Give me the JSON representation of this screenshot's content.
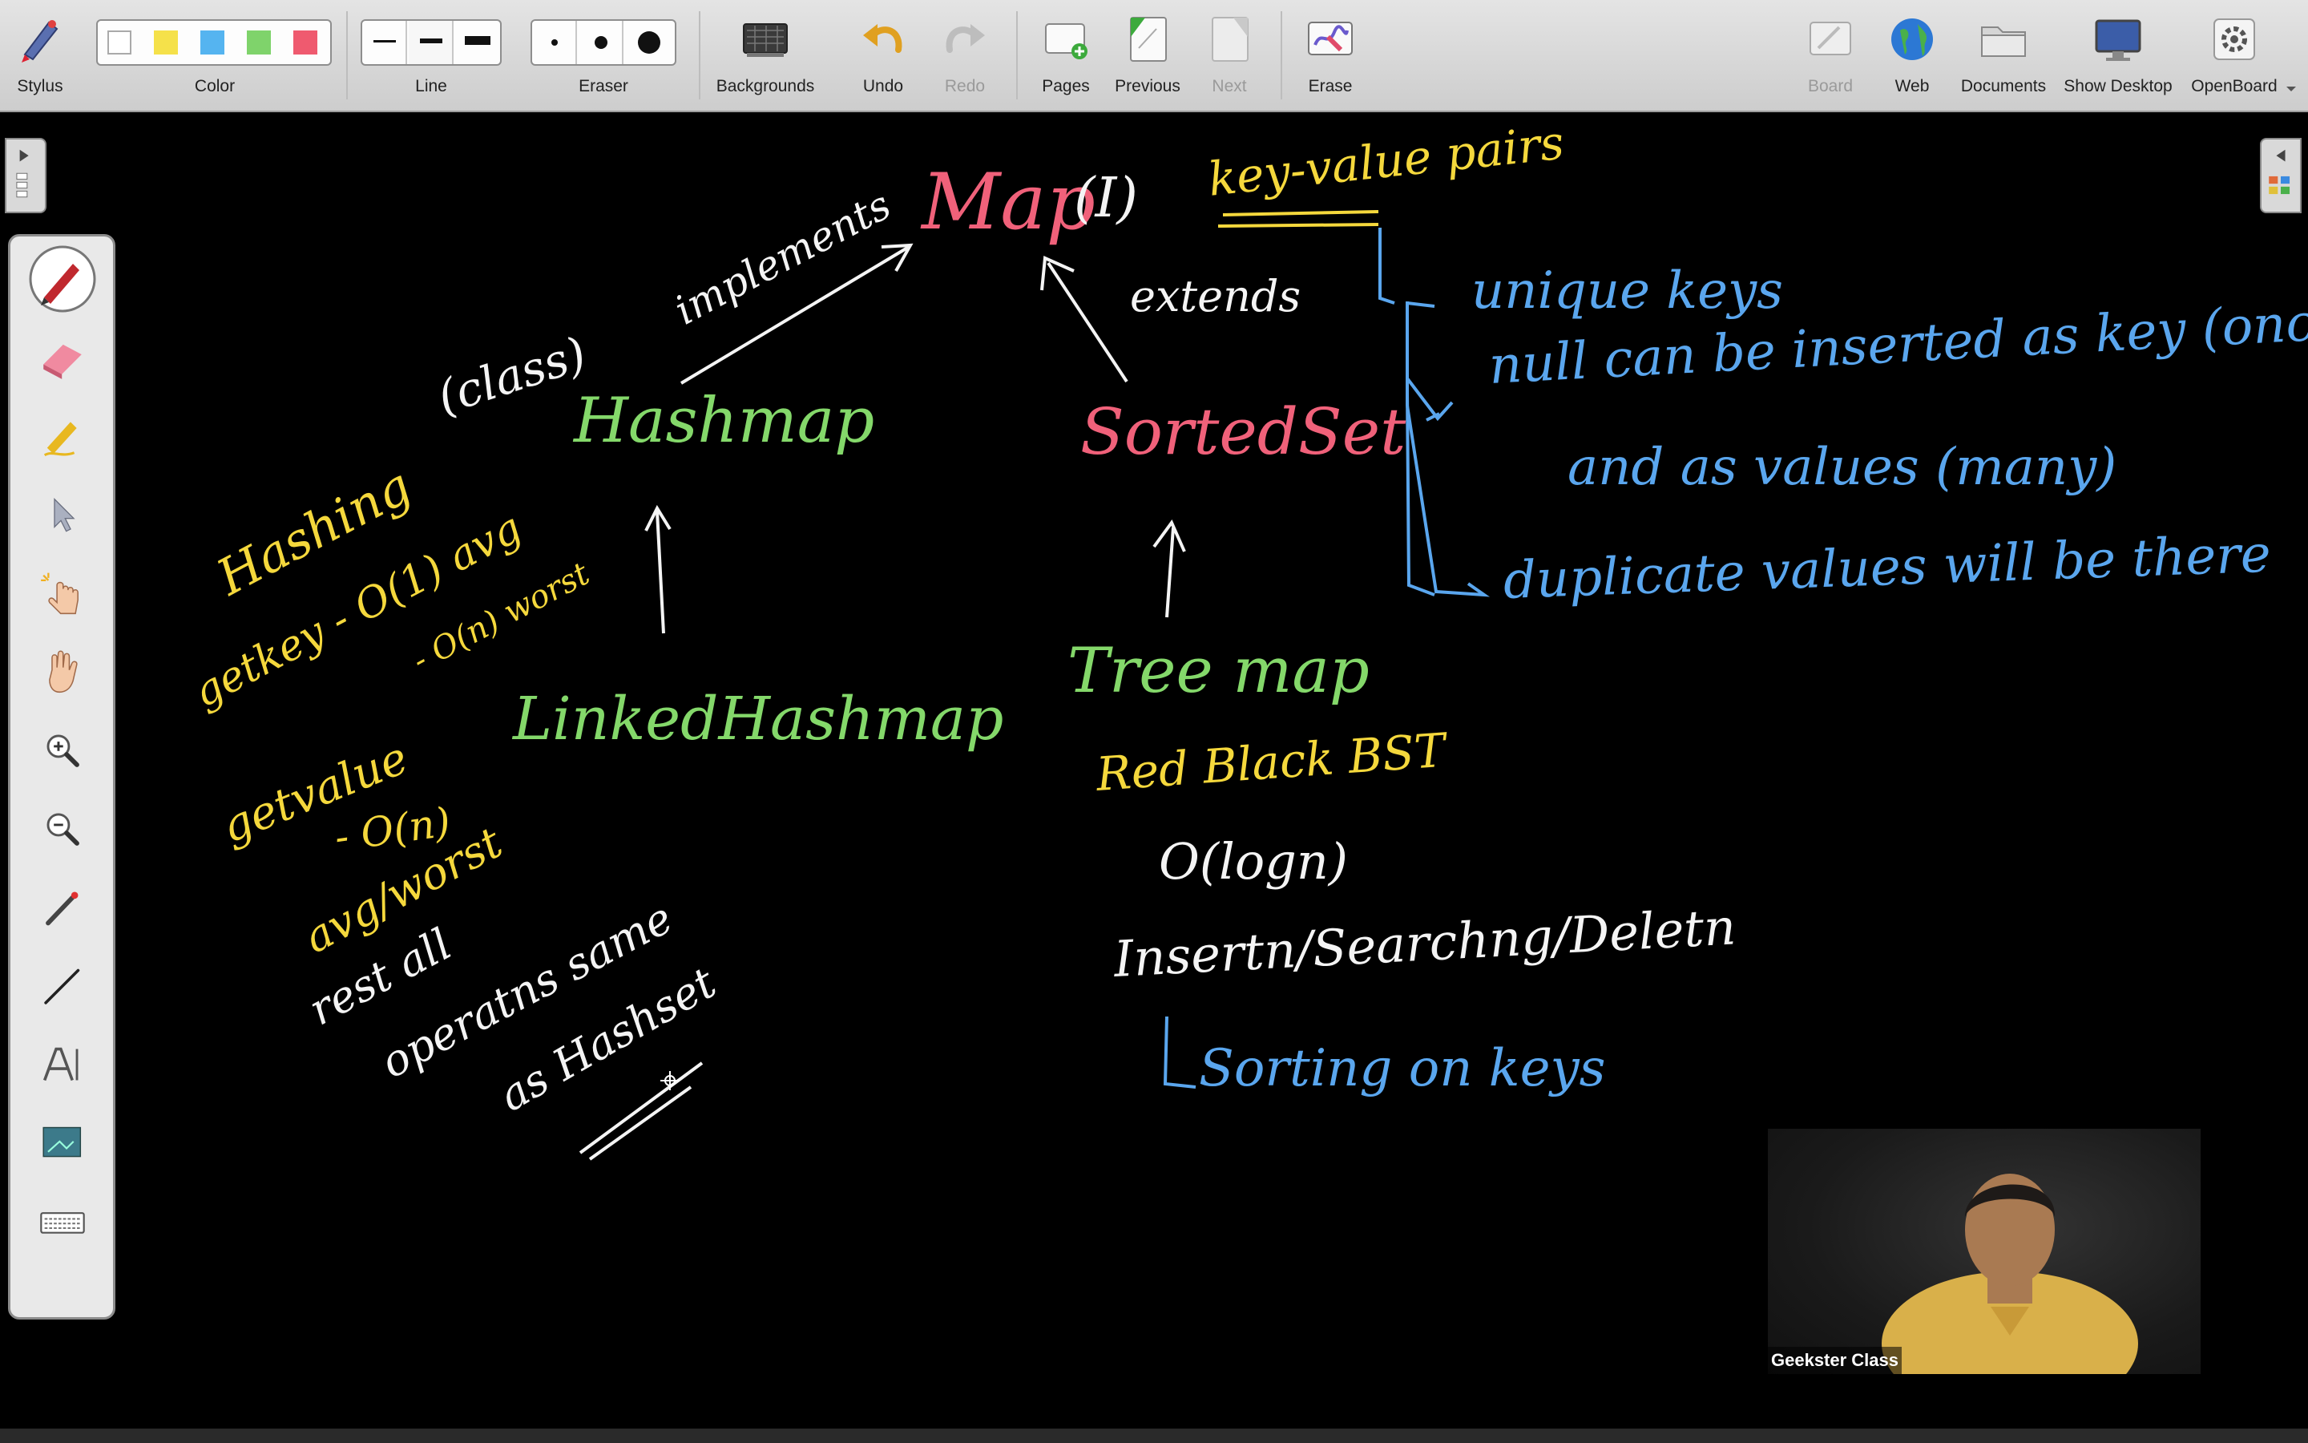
{
  "toolbar": {
    "stylus": "Stylus",
    "color": "Color",
    "line": "Line",
    "eraser": "Eraser",
    "backgrounds": "Backgrounds",
    "undo": "Undo",
    "redo": "Redo",
    "pages": "Pages",
    "previous": "Previous",
    "next": "Next",
    "erase": "Erase",
    "board": "Board",
    "web": "Web",
    "documents": "Documents",
    "show_desktop": "Show Desktop",
    "openboard": "OpenBoard",
    "colors": [
      "#ffffff",
      "#f5e14a",
      "#55b4f0",
      "#7fd36b",
      "#ef5a6f"
    ],
    "line_widths": [
      "thin",
      "medium",
      "thick"
    ],
    "eraser_sizes": [
      "small",
      "medium",
      "large"
    ]
  },
  "palette": {
    "tools": [
      "pen-icon",
      "eraser-icon",
      "marker-icon",
      "selector-icon",
      "interact-icon",
      "hand-icon",
      "zoom-in-icon",
      "zoom-out-icon",
      "laser-pointer-icon",
      "line-icon",
      "text-icon",
      "capture-icon",
      "keyboard-icon"
    ]
  },
  "board": {
    "map": "Map",
    "map_interface": "(I)",
    "key_value": "key-value pairs",
    "implements": "implements",
    "extends": "extends",
    "class": "(class)",
    "hashmap": "Hashmap",
    "sortedset": "SortedSet",
    "unique_keys": "unique keys",
    "null_keys": "null can be inserted as key (once)",
    "null_values": "and as values (many)",
    "duplicates": "duplicate values will be there",
    "hashing": "Hashing",
    "getkey": "getkey - O(1) avg",
    "worst": "- O(n) worst",
    "getvalue": "getvalue",
    "getvalue_on": "- O(n)",
    "avg_worst": "avg/worst",
    "linkedhashmap": "LinkedHashmap",
    "treemap": "Tree map",
    "redblack": "Red Black BST",
    "ologn": "O(logn)",
    "ops": "Insertn/Searchng/Deletn",
    "sorting": "Sorting on keys",
    "rest_all": "rest all",
    "operations_same": "operatns same",
    "as_hashset": "as Hashset"
  },
  "webcam": {
    "name": "Geekster Class"
  }
}
